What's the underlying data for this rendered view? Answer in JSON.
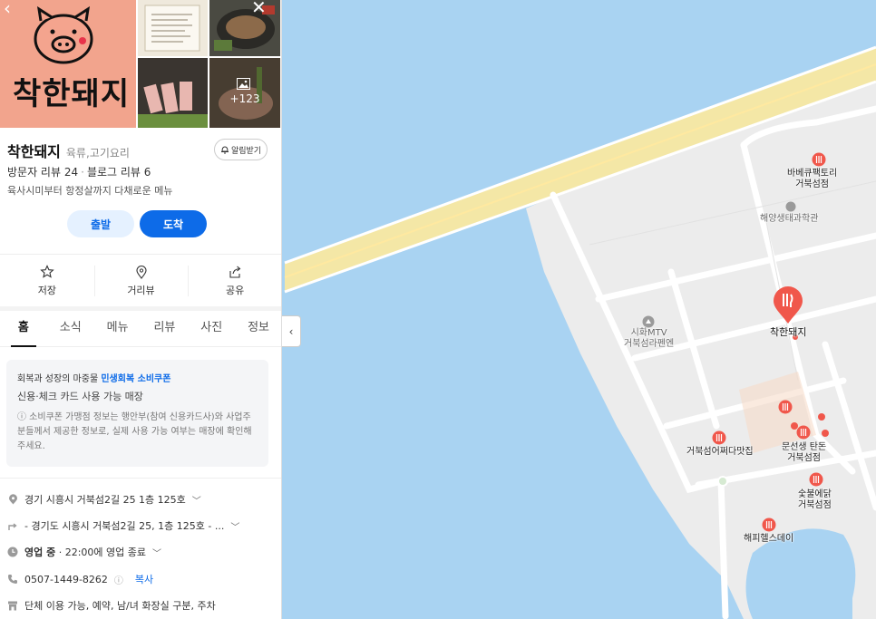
{
  "place": {
    "name": "착한돼지",
    "category": "육류,고기요리",
    "logo_text": "착한돼지",
    "photo_more_count": "+123",
    "notify_label": "알림받기",
    "visitor_reviews": "방문자 리뷰 24",
    "blog_reviews": "블로그 리뷰 6",
    "description": "육사시미부터 항정살까지 다채로운 메뉴"
  },
  "route": {
    "start_label": "출발",
    "arrive_label": "도착"
  },
  "actions": [
    {
      "label": "저장",
      "icon": "star-icon"
    },
    {
      "label": "거리뷰",
      "icon": "location-pin-icon"
    },
    {
      "label": "공유",
      "icon": "share-icon"
    }
  ],
  "tabs": [
    "홈",
    "소식",
    "메뉴",
    "리뷰",
    "사진",
    "정보"
  ],
  "active_tab": "홈",
  "coupon": {
    "line1_prefix": "회복과 성장의 마중물",
    "line1_highlight": "민생회복 소비쿠폰",
    "line2": "신용·체크 카드 사용 가능 매장",
    "note": "ⓘ 소비쿠폰 가맹점 정보는 행안부(참여 신용카드사)와 사업주분들께서 제공한 정보로, 실제 사용 가능 여부는 매장에 확인해 주세요."
  },
  "details": {
    "address": "경기 시흥시 거북섬2길 25 1층 125호",
    "directions": "- 경기도 시흥시 거북섬2길 25, 1층 125호 - ...",
    "hours_status": "영업 중",
    "hours_detail": "· 22:00에 영업 종료",
    "phone": "0507-1449-8262",
    "copy_label": "복사",
    "facilities": "단체 이용 가능, 예약, 남/녀 화장실 구분, 주차"
  },
  "map": {
    "pois": [
      {
        "name": "바베큐팩토리\n거북섬점",
        "type": "restaurant"
      },
      {
        "name": "해양생태과학관",
        "type": "landmark"
      },
      {
        "name": "시화MTV\n거북섬라펜엔",
        "type": "landmark"
      },
      {
        "name": "착한돼지",
        "type": "selected"
      },
      {
        "name": "거북섬어쩌다맛집",
        "type": "restaurant"
      },
      {
        "name": "문선생 탄돈\n거북섬점",
        "type": "restaurant"
      },
      {
        "name": "숯불에닭\n거북섬점",
        "type": "restaurant"
      },
      {
        "name": "해피헬스데이",
        "type": "restaurant"
      }
    ]
  },
  "colors": {
    "accent": "#0d6be8",
    "water": "#a9d3f2",
    "poi": "#f0574b",
    "logo_bg": "#f2a48d"
  }
}
